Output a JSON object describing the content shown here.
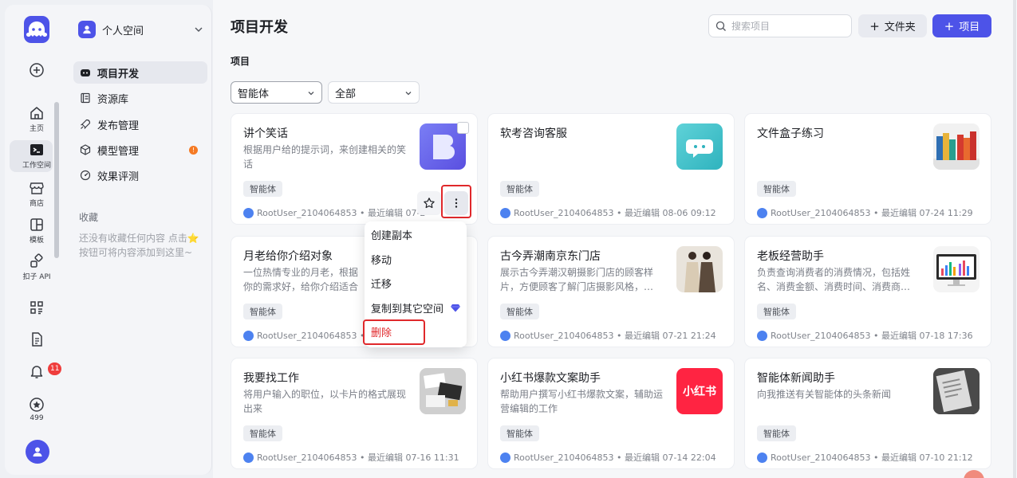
{
  "rail": {
    "items": [
      {
        "label": "主页",
        "icon": "home-icon"
      },
      {
        "label": "工作空间",
        "icon": "terminal-icon"
      },
      {
        "label": "商店",
        "icon": "store-icon"
      },
      {
        "label": "模板",
        "icon": "template-icon"
      },
      {
        "label": "扣子 API",
        "icon": "api-icon"
      }
    ],
    "notification_count": "11",
    "points": "499"
  },
  "sidebar": {
    "space_name": "个人空间",
    "nav": [
      {
        "label": "项目开发",
        "icon": "bot-icon"
      },
      {
        "label": "资源库",
        "icon": "library-icon"
      },
      {
        "label": "发布管理",
        "icon": "rocket-icon"
      },
      {
        "label": "模型管理",
        "icon": "cube-icon",
        "badge": "!"
      },
      {
        "label": "效果评测",
        "icon": "gauge-icon"
      }
    ],
    "favorites_title": "收藏",
    "favorites_empty": "还没有收藏任何内容 点击⭐按钮可将内容添加到这里~"
  },
  "header": {
    "title": "项目开发",
    "search_placeholder": "搜索项目",
    "folder_button": "文件夹",
    "project_button": "项目"
  },
  "filters": {
    "section_label": "项目",
    "type": "智能体",
    "status": "全部"
  },
  "cards": [
    {
      "title": "讲个笑话",
      "desc": "根据用户给的提示词，来创建相关的笑话",
      "tag": "智能体",
      "author": "RootUser_2104064853",
      "edited": "• 最近编辑 07-2"
    },
    {
      "title": "软考咨询客服",
      "desc": "",
      "tag": "智能体",
      "author": "RootUser_2104064853",
      "edited": "• 最近编辑 08-06 09:12"
    },
    {
      "title": "文件盒子练习",
      "desc": "",
      "tag": "智能体",
      "author": "RootUser_2104064853",
      "edited": "• 最近编辑 07-24 11:29"
    },
    {
      "title": "月老给你介绍对象",
      "desc": "一位热情专业的月老，根据你的需求好，给你介绍适合你的对象，",
      "tag": "智能体",
      "author": "RootUser_2104064853",
      "edited": "• 最"
    },
    {
      "title": "古今弄潮南京东门店",
      "desc": "展示古今弄潮汉朝摄影门店的顾客样片，方便顾客了解门店摄影风格，…",
      "tag": "智能体",
      "author": "RootUser_2104064853",
      "edited": "• 最近编辑 07-21 21:24"
    },
    {
      "title": "老板经营助手",
      "desc": "负责查询消费者的消费情况，包括姓名、消费金额、消费时间、消费商…",
      "tag": "智能体",
      "author": "RootUser_2104064853",
      "edited": "• 最近编辑 07-18 17:36"
    },
    {
      "title": "我要找工作",
      "desc": "将用户输入的职位，以卡片的格式展现出来",
      "tag": "智能体",
      "author": "RootUser_2104064853",
      "edited": "• 最近编辑 07-16 11:31"
    },
    {
      "title": "小红书爆款文案助手",
      "desc": "帮助用户撰写小红书爆款文案，辅助运营编辑的工作",
      "tag": "智能体",
      "author": "RootUser_2104064853",
      "edited": "• 最近编辑 07-14 22:04",
      "thumb_text": "小红书"
    },
    {
      "title": "智能体新闻助手",
      "desc": "向我推送有关智能体的头条新闻",
      "tag": "智能体",
      "author": "RootUser_2104064853",
      "edited": "• 最近编辑 07-10 21:12"
    }
  ],
  "context_menu": {
    "items": [
      "创建副本",
      "移动",
      "迁移",
      "复制到其它空间",
      "删除"
    ]
  },
  "colors": {
    "accent": "#4d53e8",
    "danger": "#e0282b",
    "warning_badge": "#f57a24"
  }
}
